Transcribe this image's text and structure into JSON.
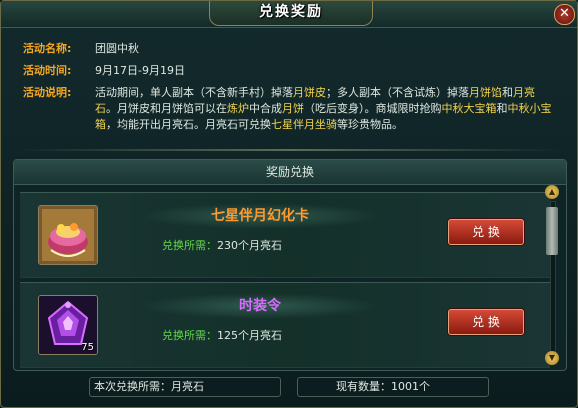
{
  "window": {
    "title": "兑换奖励",
    "close_label": "✕"
  },
  "info": {
    "name_label": "活动名称:",
    "name_value": "团圆中秋",
    "time_label": "活动时间:",
    "time_value": "9月17日-9月19日",
    "desc_label": "活动说明:",
    "desc": [
      {
        "t": "活动期间，单人副本（不含新手村）掉落",
        "h": false
      },
      {
        "t": "月饼皮",
        "h": true
      },
      {
        "t": "；多人副本（不含试炼）掉落",
        "h": false
      },
      {
        "t": "月饼馅",
        "h": true
      },
      {
        "t": "和",
        "h": false
      },
      {
        "t": "月亮石",
        "h": true
      },
      {
        "t": "。月饼皮和月饼馅可以在",
        "h": false
      },
      {
        "t": "炼炉",
        "h": true
      },
      {
        "t": "中合成",
        "h": false
      },
      {
        "t": "月饼",
        "h": true
      },
      {
        "t": "（吃后变身）。商城限时抢购",
        "h": false
      },
      {
        "t": "中秋大宝箱",
        "h": true
      },
      {
        "t": "和",
        "h": false
      },
      {
        "t": "中秋小宝箱",
        "h": true
      },
      {
        "t": "，均能开出月亮石。月亮石可兑换",
        "h": false
      },
      {
        "t": "七星伴月坐骑",
        "h": true
      },
      {
        "t": "等珍贵物品。",
        "h": false
      }
    ]
  },
  "panel": {
    "header": "奖励兑换",
    "items": [
      {
        "name": "七星伴月幻化卡",
        "name_color": "#ff9a2e",
        "cost_label": "兑换所需：",
        "cost_value": "230个月亮石",
        "button": "兑 换",
        "icon": "mooncake-box-icon",
        "count": ""
      },
      {
        "name": "时装令",
        "name_color": "#d86cff",
        "cost_label": "兑换所需：",
        "cost_value": "125个月亮石",
        "button": "兑 换",
        "icon": "purple-token-icon",
        "count": "75"
      }
    ]
  },
  "scrollbar": {
    "up": "▲",
    "down": "▼"
  },
  "footer": {
    "required_label": "本次兑换所需：",
    "required_value": "月亮石",
    "owned_label": "现有数量：",
    "owned_value": "1001个"
  }
}
